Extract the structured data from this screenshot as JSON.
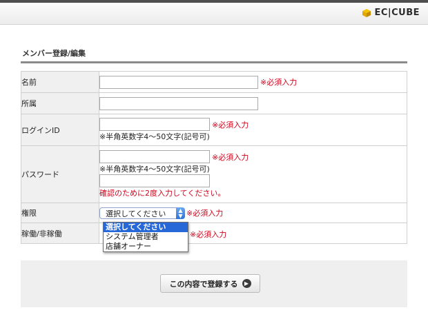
{
  "header": {
    "logo_text": "EC|CUBE"
  },
  "page": {
    "title": "メンバー登録/編集"
  },
  "form": {
    "required_label": "※必須入力",
    "rows": {
      "name": {
        "label": "名前"
      },
      "affiliation": {
        "label": "所属"
      },
      "login_id": {
        "label": "ログインID",
        "note": "※半角英数字4～50文字(記号可)"
      },
      "password": {
        "label": "パスワード",
        "note": "※半角英数字4～50文字(記号可)",
        "confirm_note": "確認のために2度入力してください。"
      },
      "authority": {
        "label": "権限",
        "selected": "選択してください",
        "options": [
          "選択してください",
          "システム管理者",
          "店舗オーナー"
        ]
      },
      "status": {
        "label": "稼働/非稼働"
      }
    }
  },
  "footer": {
    "submit_label": "この内容で登録する"
  },
  "colors": {
    "required": "#d0021b",
    "select_highlight": "#2668d8"
  }
}
